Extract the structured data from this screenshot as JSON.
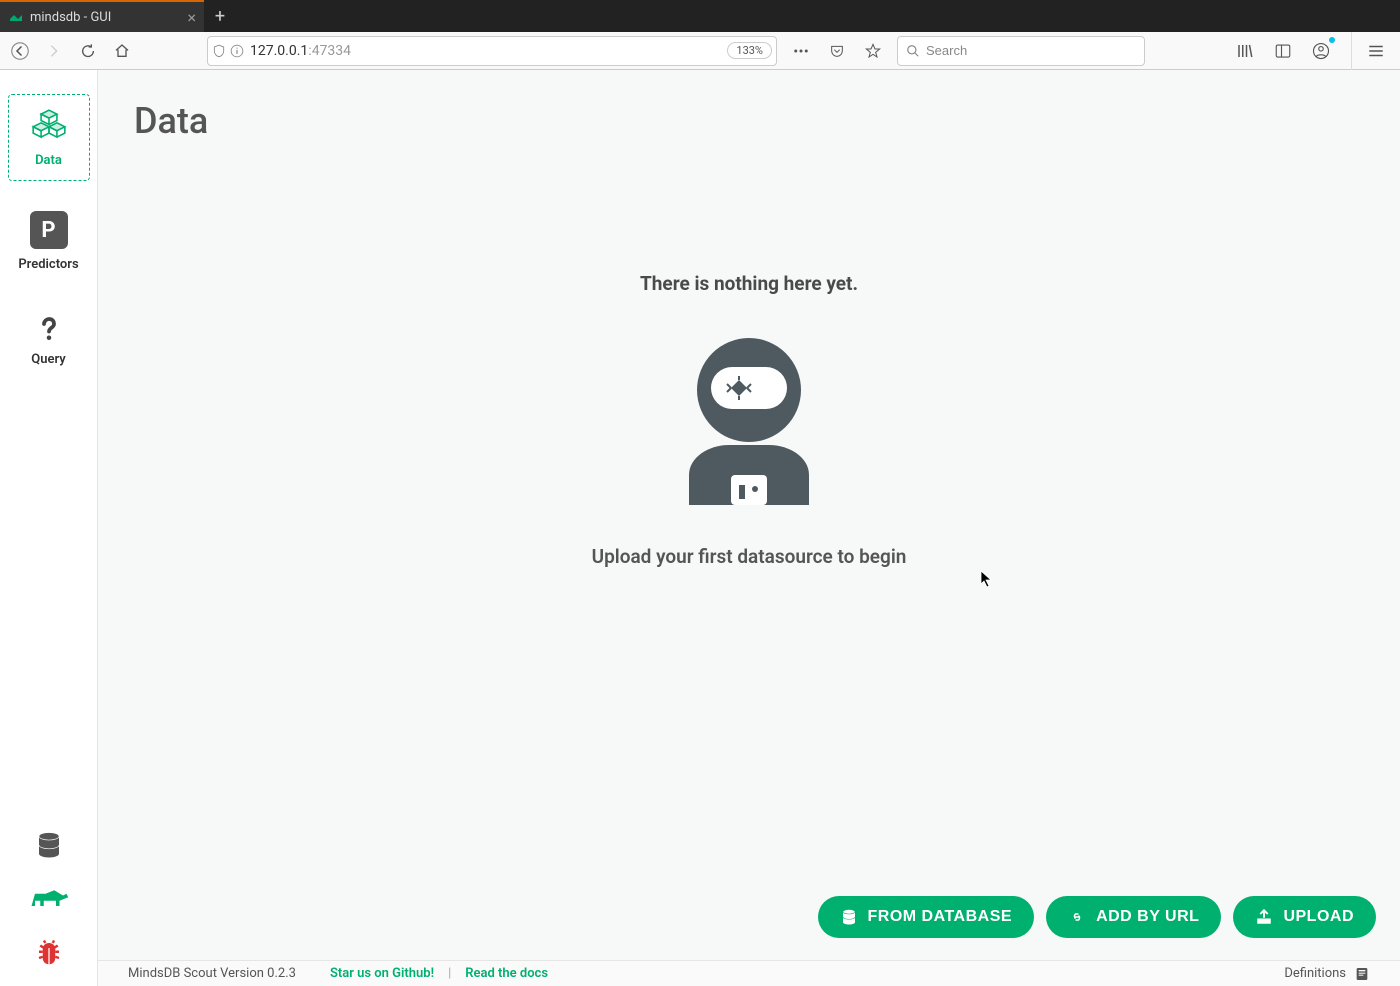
{
  "browser": {
    "tab_title": "mindsdb - GUI",
    "url_host": "127.0.0.1",
    "url_port": ":47334",
    "zoom_label": "133%",
    "search_placeholder": "Search"
  },
  "sidebar": {
    "items": [
      {
        "label": "Data"
      },
      {
        "label": "Predictors"
      },
      {
        "label": "Query"
      }
    ]
  },
  "page": {
    "title": "Data",
    "empty_title": "There is nothing here yet.",
    "empty_subtitle": "Upload your first datasource to begin"
  },
  "actions": {
    "from_database": "FROM DATABASE",
    "add_by_url": "ADD BY URL",
    "upload": "UPLOAD"
  },
  "footer": {
    "version": "MindsDB Scout Version 0.2.3",
    "github": "Star us on Github!",
    "docs": "Read the docs",
    "definitions": "Definitions"
  }
}
